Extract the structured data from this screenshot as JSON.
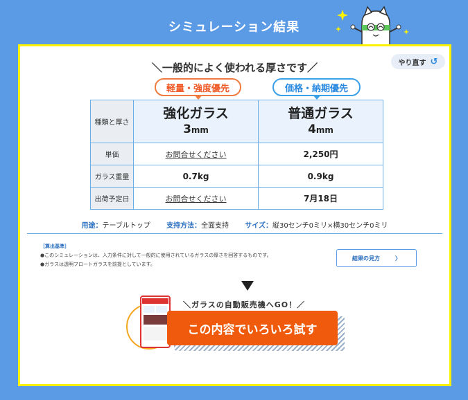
{
  "header": {
    "title": "シミュレーション結果"
  },
  "redo": {
    "label": "やり直す",
    "icon": "return-arrow-icon"
  },
  "heading": "＼一般的によく使われる厚さです／",
  "badges": {
    "strength": "軽量・強度優先",
    "price": "価格・納期優先"
  },
  "table": {
    "rows": [
      {
        "label": "種類と厚さ"
      },
      {
        "label": "単価"
      },
      {
        "label": "ガラス重量"
      },
      {
        "label": "出荷予定日"
      }
    ],
    "col1": {
      "name": "強化ガラス",
      "thickness": "3",
      "unit": "mm",
      "price": "お問合せください",
      "weight": "0.7kg",
      "ship": "お問合せください"
    },
    "col2": {
      "name": "普通ガラス",
      "thickness": "4",
      "unit": "mm",
      "price": "2,250円",
      "weight": "0.9kg",
      "ship": "7月18日"
    }
  },
  "conditions": {
    "use_key": "用途：",
    "use_val": "テーブルトップ",
    "support_key": "支持方法：",
    "support_val": "全面支持",
    "size_key": "サイズ：",
    "size_val": "縦30センチ0ミリ×横30センチ0ミリ"
  },
  "basis": {
    "title": "［算出基準］",
    "line1": "●このシミュレーションは、入力条件に対して一般的に使用されているガラスの厚さを回答するものです。",
    "line2": "●ガラスは透明フロートガラスを前提としています。"
  },
  "view_button": {
    "label": "結果の見方",
    "icon": "chevron-right-icon"
  },
  "vending": "＼ガラスの自動販売機へGO！／",
  "try_button": {
    "label": "この内容でいろいろ試す"
  },
  "colors": {
    "background": "#5b9be6",
    "panel_border": "#fff200",
    "accent_orange": "#f05a0c",
    "accent_blue": "#2a8ae0"
  }
}
